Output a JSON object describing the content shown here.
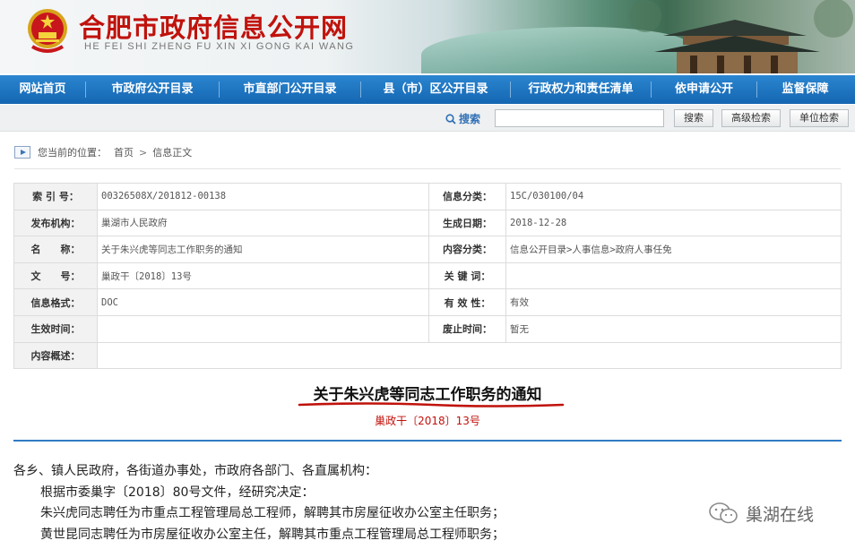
{
  "header": {
    "title": "合肥市政府信息公开网",
    "pinyin": "HE FEI SHI ZHENG FU XIN XI GONG KAI WANG"
  },
  "nav": [
    {
      "label": "网站首页"
    },
    {
      "label": "市政府公开目录"
    },
    {
      "label": "市直部门公开目录"
    },
    {
      "label": "县（市）区公开目录"
    },
    {
      "label": "行政权力和责任清单"
    },
    {
      "label": "依申请公开"
    },
    {
      "label": "监督保障"
    }
  ],
  "search": {
    "label": "搜索",
    "input_value": "",
    "search_button": "搜索",
    "advanced_button": "高级检索",
    "unit_button": "单位检索"
  },
  "breadcrumb": {
    "prefix": "您当前的位置：",
    "items": [
      "首页",
      "信息正文"
    ]
  },
  "meta": {
    "rows": [
      {
        "k1": "索 引 号：",
        "v1": "00326508X/201812-00138",
        "k2": "信息分类：",
        "v2": "15C/030100/04"
      },
      {
        "k1": "发布机构：",
        "v1": "巢湖市人民政府",
        "k2": "生成日期：",
        "v2": "2018-12-28"
      },
      {
        "k1": "名　　称：",
        "v1": "关于朱兴虎等同志工作职务的通知",
        "k2": "内容分类：",
        "v2": "信息公开目录>人事信息>政府人事任免"
      },
      {
        "k1": "文　　号：",
        "v1": "巢政干〔2018〕13号",
        "k2": "关 键 词：",
        "v2": ""
      },
      {
        "k1": "信息格式：",
        "v1": "DOC",
        "k2": "有 效 性：",
        "v2": "有效"
      },
      {
        "k1": "生效时间：",
        "v1": "",
        "k2": "废止时间：",
        "v2": "暂无"
      },
      {
        "k1": "内容概述：",
        "v1": ""
      }
    ]
  },
  "document": {
    "title": "关于朱兴虎等同志工作职务的通知",
    "number": "巢政干〔2018〕13号",
    "lines": [
      "各乡、镇人民政府，各街道办事处，市政府各部门、各直属机构：",
      "根据市委巢字〔2018〕80号文件，经研究决定：",
      "朱兴虎同志聘任为市重点工程管理局总工程师，解聘其市房屋征收办公室主任职务；",
      "黄世昆同志聘任为市房屋征收办公室主任，解聘其市重点工程管理局总工程师职务；"
    ]
  },
  "watermark": {
    "text": "巢湖在线"
  },
  "colors": {
    "nav_bg": "#1466b2",
    "title_red": "#c0120c",
    "divider_blue": "#2f7bc4"
  }
}
